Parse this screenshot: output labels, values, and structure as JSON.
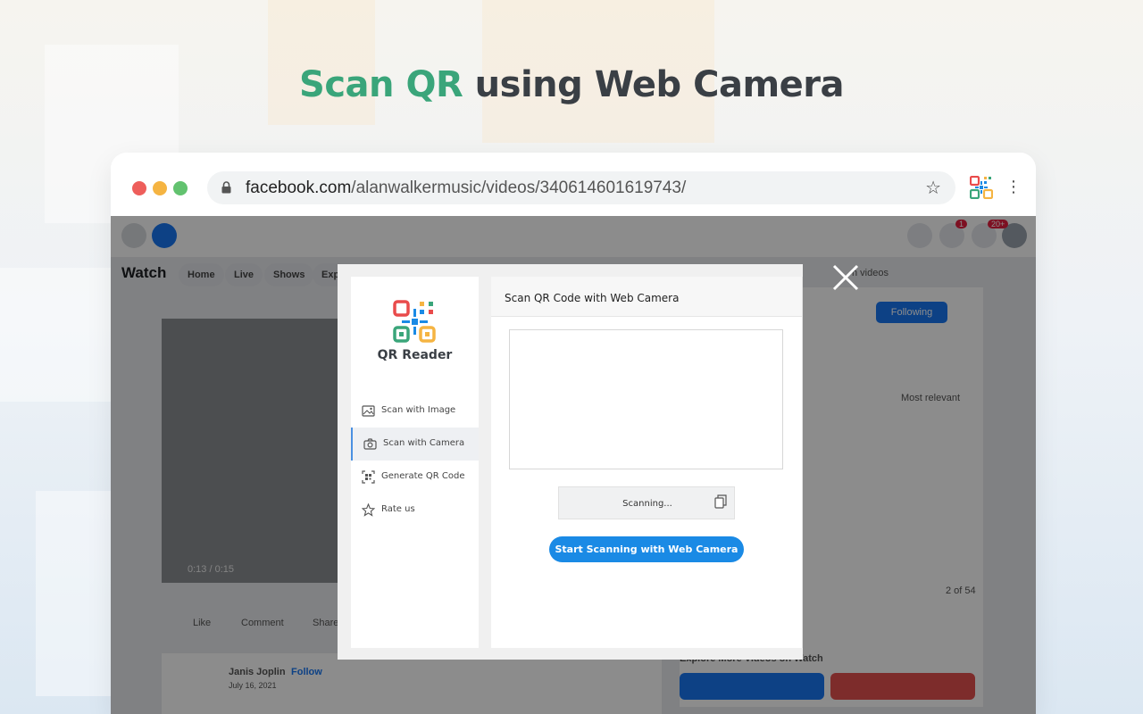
{
  "headline": {
    "accent": "Scan QR",
    "rest": " using Web Camera"
  },
  "browser": {
    "url_domain": "facebook.com",
    "url_path": "/alanwalkermusic/videos/340614601619743/",
    "traffic_lights": [
      "#ee5e5b",
      "#f5b442",
      "#62c26f"
    ]
  },
  "fb": {
    "watch_title": "Watch",
    "tabs": [
      "Home",
      "Live",
      "Shows",
      "Exp"
    ],
    "search_placeholder": "h videos",
    "following": "Following",
    "sort": "Most relevant",
    "video_time": "0:13 / 0:15",
    "counter": "2 of 54",
    "actions": [
      "Like",
      "Comment",
      "Share"
    ],
    "author": "Janis Joplin",
    "follow": "Follow",
    "date": "July 16, 2021",
    "explore": "Explore More Videos on Watch",
    "badges": [
      "1",
      "20+"
    ]
  },
  "extension": {
    "brand": "QR Reader",
    "nav": [
      {
        "label": "Scan with Image",
        "icon": "image-icon"
      },
      {
        "label": "Scan with Camera",
        "icon": "camera-icon"
      },
      {
        "label": "Generate QR Code",
        "icon": "qr-code-icon"
      },
      {
        "label": "Rate us",
        "icon": "star-icon"
      }
    ],
    "panel_title": "Scan QR Code with Web Camera",
    "status": "Scanning...",
    "start_button": "Start Scanning with Web Camera",
    "accent": "#1a8ae5"
  }
}
